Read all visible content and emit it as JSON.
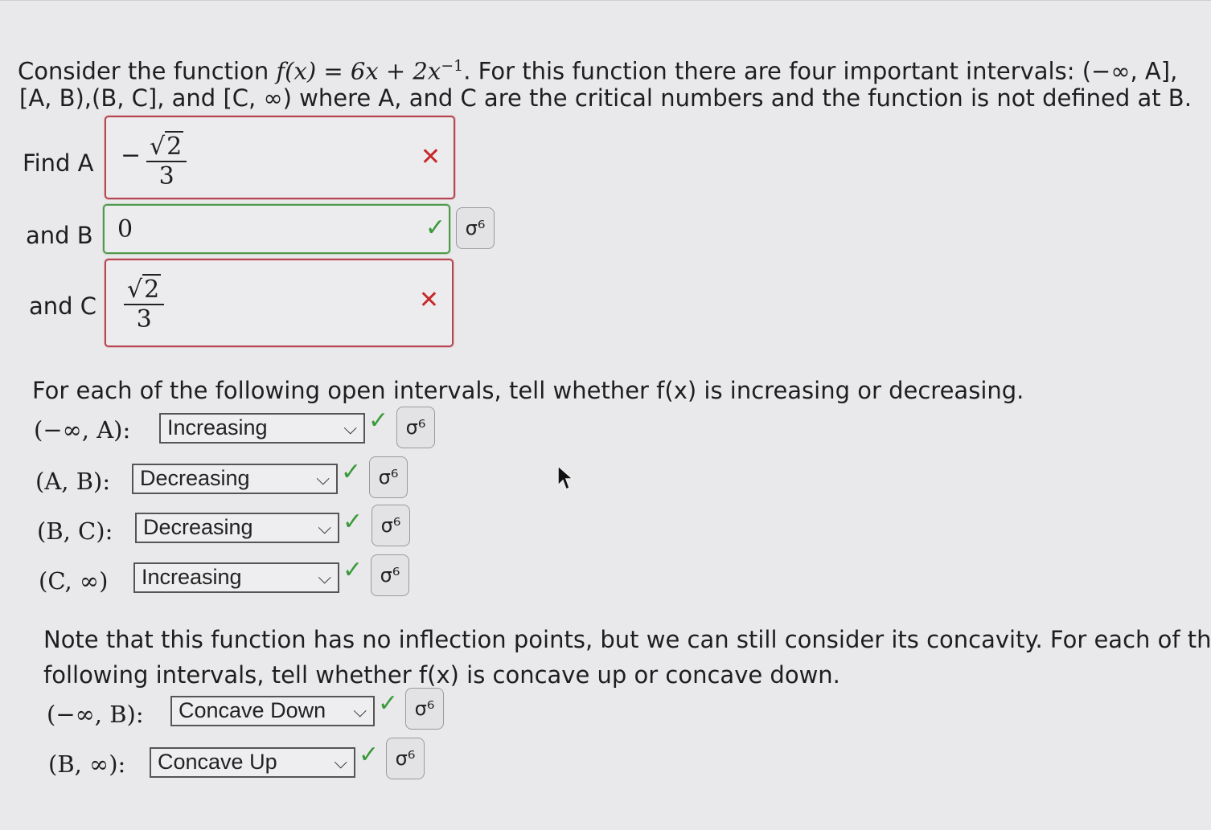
{
  "problem": {
    "line1_a": "Consider the function ",
    "func": "f(x) = 6x + 2x",
    "exp": "−1",
    "line1_b": ". For this function there are four important intervals: (−∞, A],",
    "line2": "[A, B),(B, C], and [C, ∞) where A, and C are the critical numbers and the function is not defined at B."
  },
  "critical": {
    "find_a_label": "Find A",
    "a_neg": "−",
    "a_num": "2",
    "a_den": "3",
    "find_b_label": "and B",
    "b_value": "0",
    "find_c_label": "and C",
    "c_num": "2",
    "c_den": "3",
    "wrong_mark": "✕",
    "correct_mark": "✓"
  },
  "monotonic": {
    "prompt": "For each of the following open intervals, tell whether f(x) is increasing or decreasing.",
    "rows": [
      {
        "interval": "(−∞, A):",
        "value": "Increasing"
      },
      {
        "interval": "(A, B):",
        "value": "Decreasing"
      },
      {
        "interval": "(B, C):",
        "value": "Decreasing"
      },
      {
        "interval": "(C, ∞)",
        "value": "Increasing"
      }
    ]
  },
  "concavity": {
    "prompt_line1": "Note that this function has no inflection points, but we can still consider its concavity. For each of the",
    "prompt_line2": "following intervals, tell whether f(x) is concave up or concave down.",
    "rows": [
      {
        "interval": "(−∞, B):",
        "value": "Concave Down"
      },
      {
        "interval": "(B, ∞):",
        "value": "Concave Up"
      }
    ]
  },
  "icons": {
    "key": "σ⁶",
    "chevron": "⌵",
    "check": "✓"
  },
  "colors": {
    "correct": "#3a9a3a",
    "wrong": "#c62828"
  }
}
